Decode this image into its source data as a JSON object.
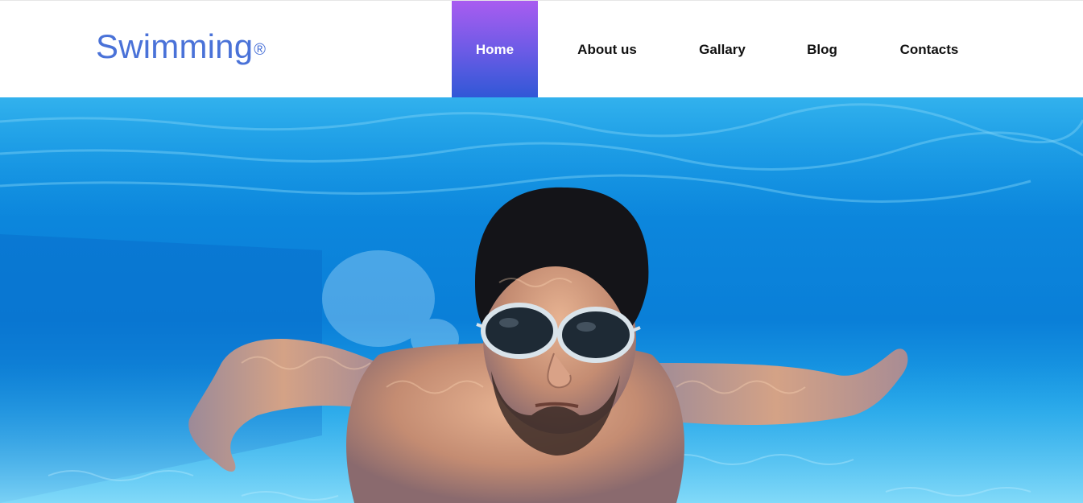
{
  "brand": {
    "name": "Swimming",
    "mark": "®",
    "color": "#4a72d8"
  },
  "nav": {
    "items": [
      {
        "label": "Home",
        "active": true
      },
      {
        "label": "About us",
        "active": false
      },
      {
        "label": "Gallary",
        "active": false
      },
      {
        "label": "Blog",
        "active": false
      },
      {
        "label": "Contacts",
        "active": false
      }
    ],
    "active_gradient": [
      "#a95cf0",
      "#2f58d6"
    ]
  },
  "hero": {
    "image": "underwater-swimmer-with-goggles-photo",
    "water_color": "#0a7fd8"
  }
}
